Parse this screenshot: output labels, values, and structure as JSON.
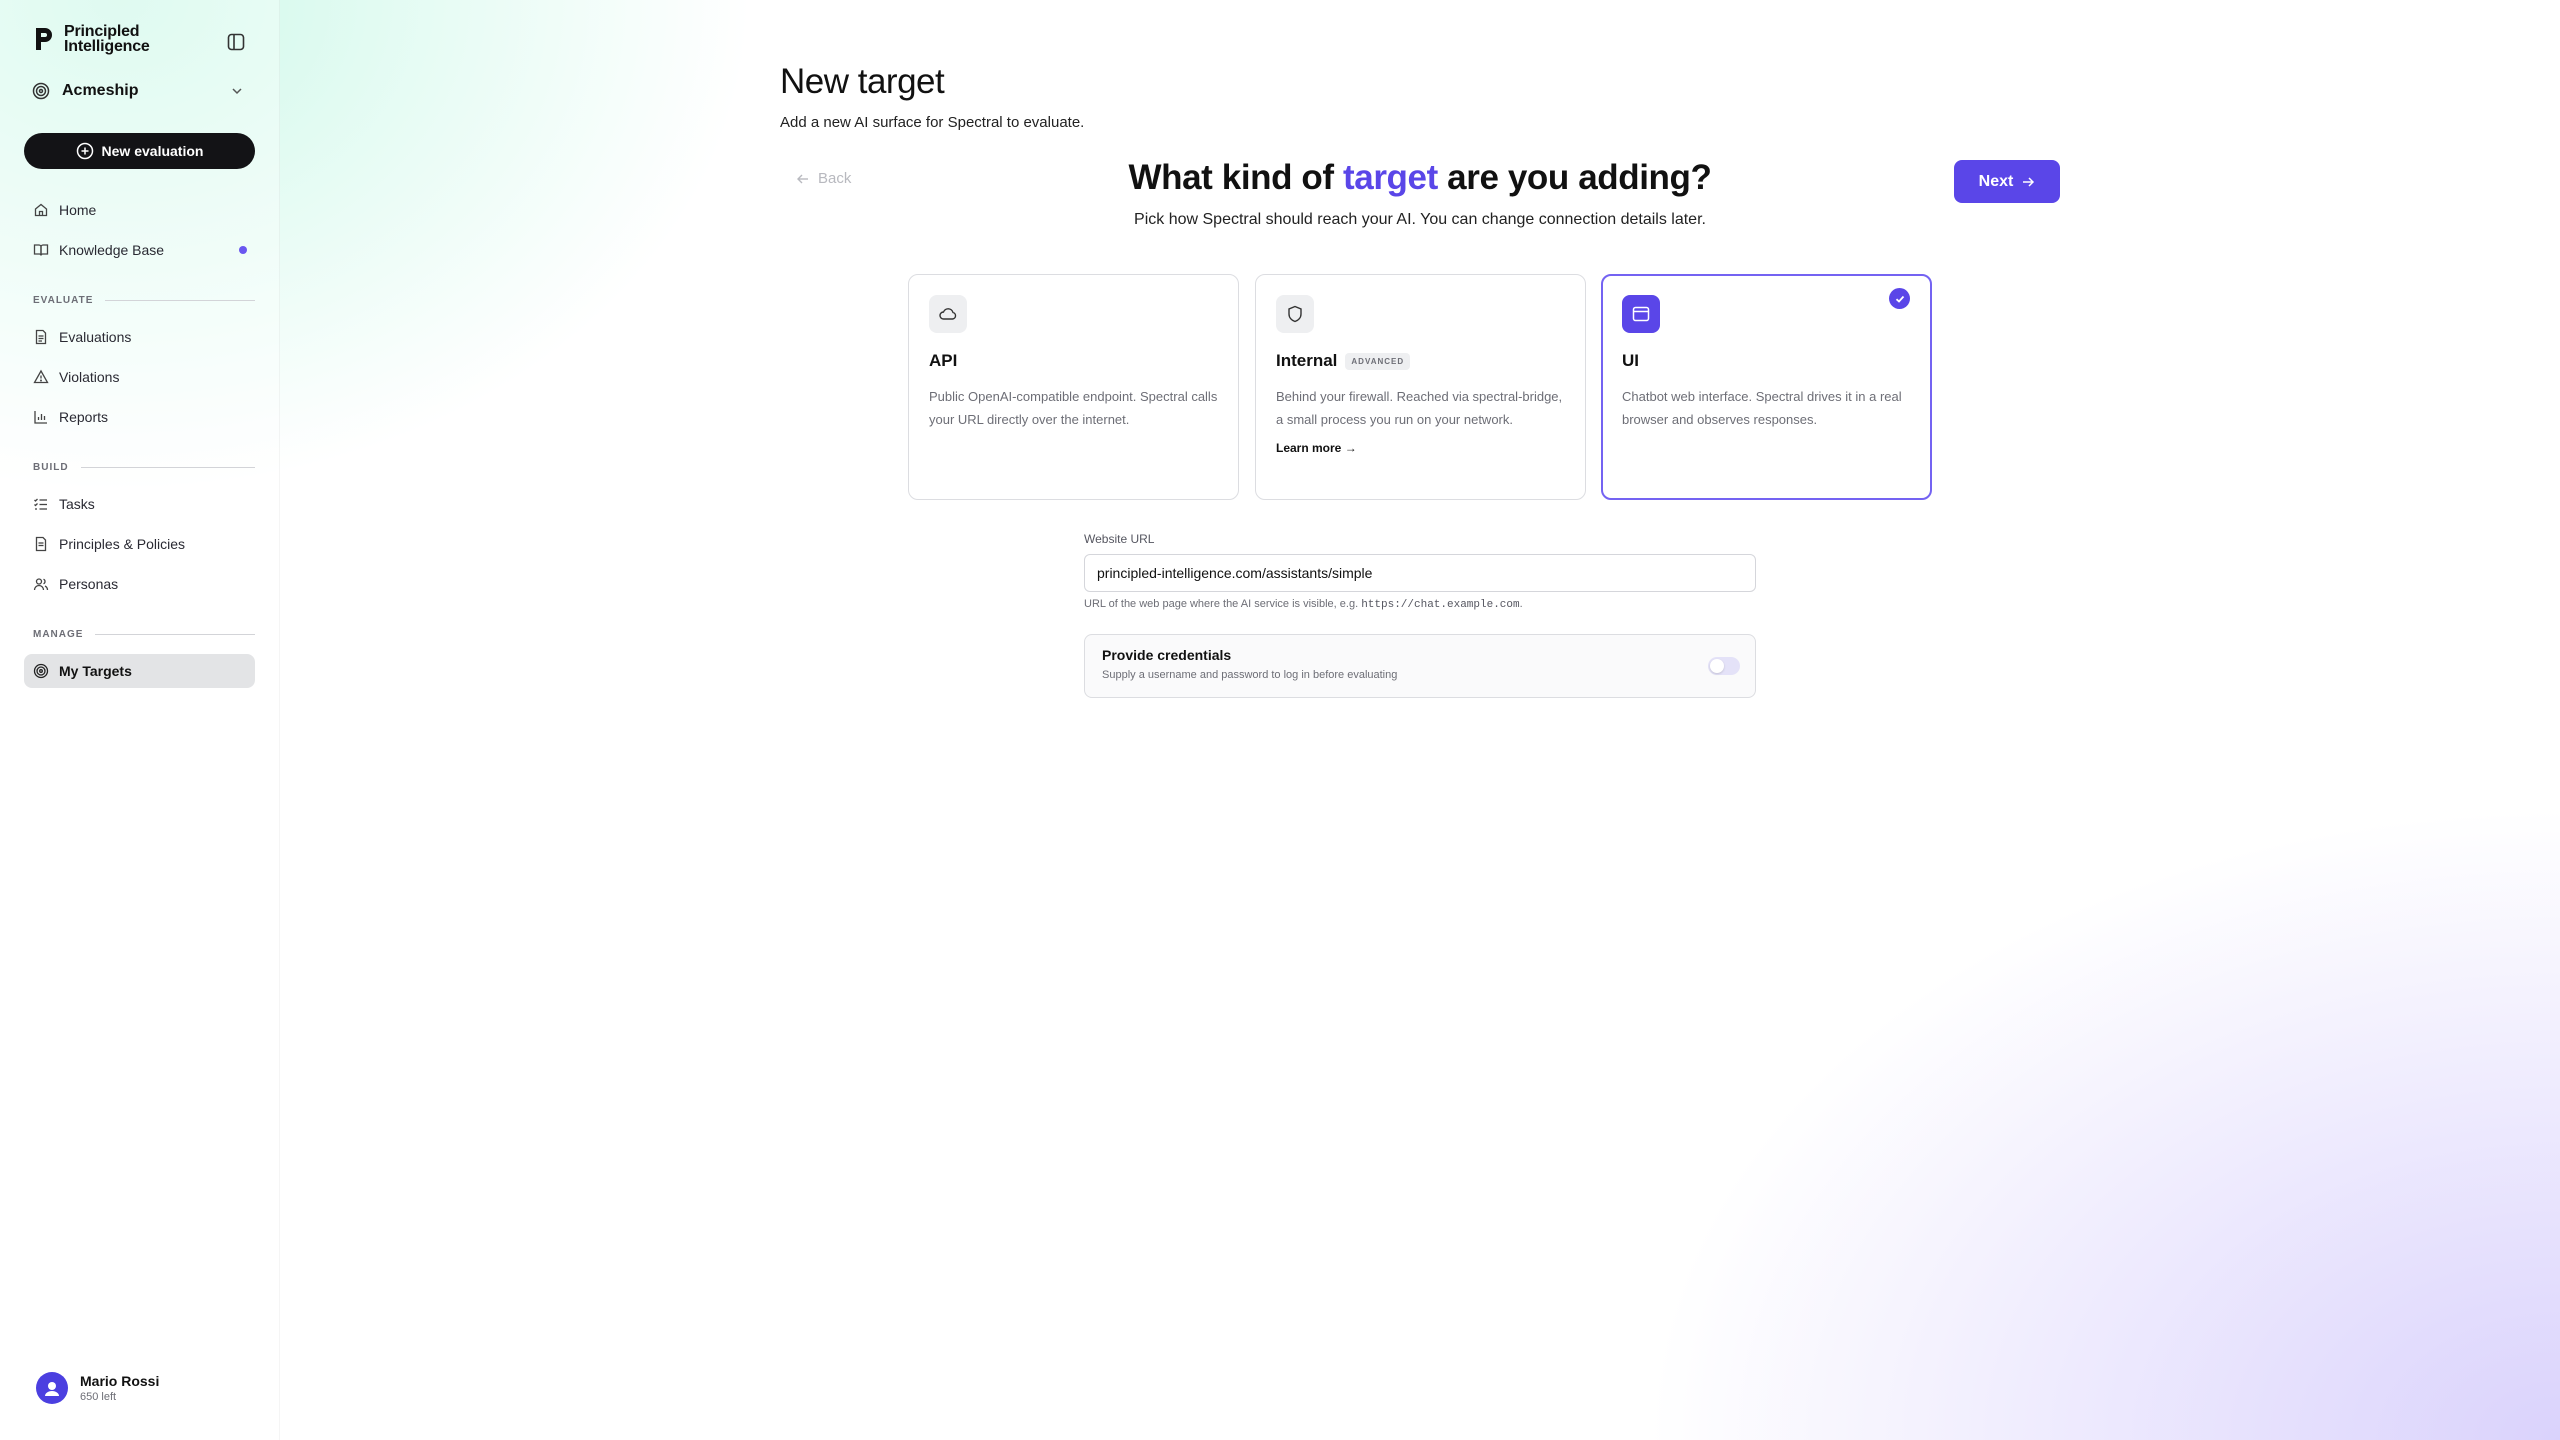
{
  "brand": {
    "line1": "Principled",
    "line2": "Intelligence"
  },
  "org": {
    "name": "Acmeship"
  },
  "sidebar": {
    "new_eval_label": "New evaluation",
    "top_items": [
      {
        "label": "Home",
        "icon": "home-icon"
      },
      {
        "label": "Knowledge Base",
        "icon": "book-icon"
      }
    ],
    "sections": {
      "evaluate": "EVALUATE",
      "build": "BUILD",
      "manage": "MANAGE"
    },
    "evaluate_items": [
      {
        "label": "Evaluations",
        "icon": "document-icon"
      },
      {
        "label": "Violations",
        "icon": "warning-icon"
      },
      {
        "label": "Reports",
        "icon": "bar-chart-icon"
      }
    ],
    "build_items": [
      {
        "label": "Tasks",
        "icon": "checklist-icon"
      },
      {
        "label": "Principles & Policies",
        "icon": "document-icon"
      },
      {
        "label": "Personas",
        "icon": "users-icon"
      }
    ],
    "manage_items": [
      {
        "label": "My Targets",
        "icon": "target-icon",
        "active": true
      }
    ]
  },
  "user": {
    "name": "Mario Rossi",
    "sub": "650 left"
  },
  "page": {
    "title": "New target",
    "subtitle": "Add a new AI surface for Spectral to evaluate."
  },
  "wizard": {
    "back_label": "Back",
    "next_label": "Next",
    "question_pre": "What kind of ",
    "question_hl": "target",
    "question_post": " are you adding?",
    "question_sub": "Pick how Spectral should reach your AI. You can change connection details later.",
    "options": [
      {
        "title": "API",
        "icon": "cloud-icon",
        "desc": "Public OpenAI-compatible endpoint. Spectral calls your URL directly over the internet."
      },
      {
        "title": "Internal",
        "icon": "shield-icon",
        "badge": "ADVANCED",
        "desc": "Behind your firewall. Reached via spectral-bridge, a small process you run on your network.",
        "link": "Learn more →"
      },
      {
        "title": "UI",
        "icon": "browser-window-icon",
        "desc": "Chatbot web interface. Spectral drives it in a real browser and observes responses.",
        "selected": true
      }
    ]
  },
  "form": {
    "url_label": "Website URL",
    "url_value": "principled-intelligence.com/assistants/simple",
    "url_help_pre": "URL of the web page where the AI service is visible, e.g. ",
    "url_help_code": "https://chat.example.com",
    "url_help_post": ".",
    "cred_title": "Provide credentials",
    "cred_sub": "Supply a username and password to log in before evaluating",
    "cred_enabled": false
  },
  "colors": {
    "accent": "#5a46e8",
    "dark_button": "#131316"
  }
}
